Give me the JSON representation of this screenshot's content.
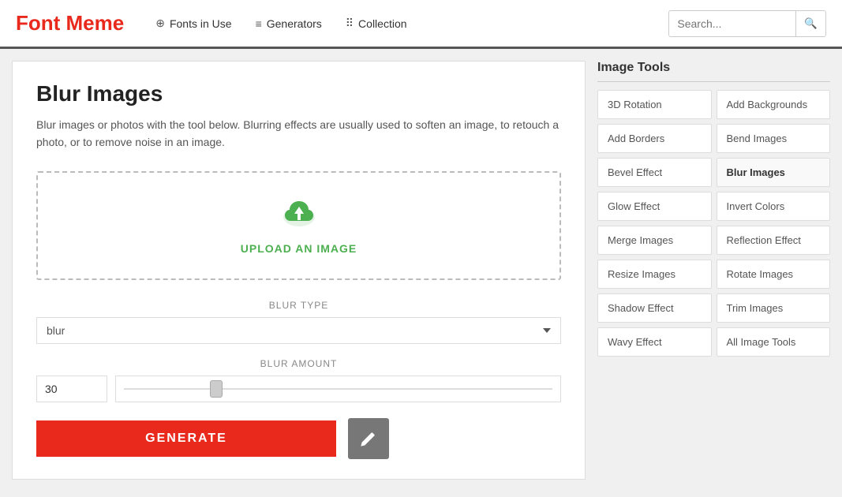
{
  "header": {
    "logo": "Font Meme",
    "nav": [
      {
        "id": "fonts-in-use",
        "label": "Fonts in Use",
        "icon": "⊕"
      },
      {
        "id": "generators",
        "label": "Generators",
        "icon": "≡"
      },
      {
        "id": "collection",
        "label": "Collection",
        "icon": "⠿"
      }
    ],
    "search": {
      "placeholder": "Search..."
    }
  },
  "main": {
    "title": "Blur Images",
    "description": "Blur images or photos with the tool below. Blurring effects are usually used to soften an image, to retouch a photo, or to remove noise in an image.",
    "upload_label": "UPLOAD AN IMAGE",
    "blur_type_label": "BLUR TYPE",
    "blur_type_value": "blur",
    "blur_amount_label": "BLUR AMOUNT",
    "blur_amount_value": "30",
    "generate_label": "GENERATE"
  },
  "sidebar": {
    "title": "Image Tools",
    "tools": [
      {
        "id": "3d-rotation",
        "label": "3D Rotation"
      },
      {
        "id": "add-backgrounds",
        "label": "Add Backgrounds"
      },
      {
        "id": "add-borders",
        "label": "Add Borders"
      },
      {
        "id": "bend-images",
        "label": "Bend Images"
      },
      {
        "id": "bevel-effect",
        "label": "Bevel Effect"
      },
      {
        "id": "blur-images",
        "label": "Blur Images"
      },
      {
        "id": "glow-effect",
        "label": "Glow Effect"
      },
      {
        "id": "invert-colors",
        "label": "Invert Colors"
      },
      {
        "id": "merge-images",
        "label": "Merge Images"
      },
      {
        "id": "reflection-effect",
        "label": "Reflection Effect"
      },
      {
        "id": "resize-images",
        "label": "Resize Images"
      },
      {
        "id": "rotate-images",
        "label": "Rotate Images"
      },
      {
        "id": "shadow-effect",
        "label": "Shadow Effect"
      },
      {
        "id": "trim-images",
        "label": "Trim Images"
      },
      {
        "id": "wavy-effect",
        "label": "Wavy Effect"
      },
      {
        "id": "all-image-tools",
        "label": "All Image Tools"
      }
    ]
  }
}
